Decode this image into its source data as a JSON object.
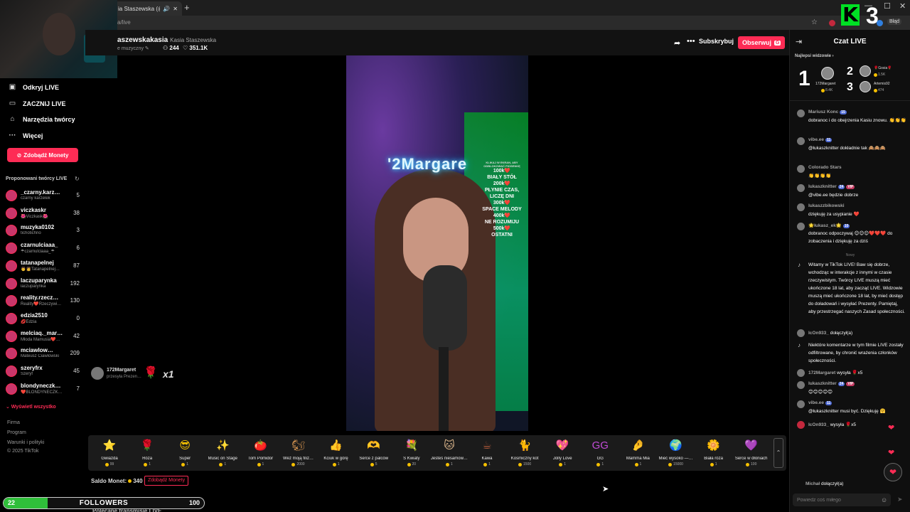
{
  "browser": {
    "tab_title": "ia Staszewska (@stasz…",
    "url": "a/live",
    "error_button": "Błąd",
    "win_controls": [
      "—",
      "☐",
      "✕"
    ]
  },
  "overlay": {
    "k_number": "3"
  },
  "sidebar": {
    "nav": [
      {
        "label": "Odkryj LIVE",
        "icon": "live-icon"
      },
      {
        "label": "ZACZNIJ LIVE",
        "icon": "camera-icon"
      },
      {
        "label": "Narzędzia twórcy",
        "icon": "home-icon"
      },
      {
        "label": "Więcej",
        "icon": "more-icon"
      }
    ],
    "coins_button": "Zdobądź Monety",
    "suggested_title": "Proponowani twórcy LIVE",
    "creators": [
      {
        "name": "_czarny.karz…",
        "sub": "czarny karzelek",
        "count": "5"
      },
      {
        "name": "viczkaskr",
        "sub": "🌺Viczkask🌺",
        "count": "38"
      },
      {
        "name": "muzyka0102",
        "sub": "tichotichno",
        "count": "3"
      },
      {
        "name": "czarnulciaaa_",
        "sub": "☂czarnulciaaa_☂",
        "count": "6"
      },
      {
        "name": "tatanapelnej",
        "sub": "👨👩Tatanapelnej…",
        "count": "87"
      },
      {
        "name": "laczuparynka",
        "sub": "laczuparynka",
        "count": "192"
      },
      {
        "name": "reality.rzecz…",
        "sub": "Reality❤️Rzeczywi…",
        "count": "130"
      },
      {
        "name": "edzia2510",
        "sub": "💋Edzia",
        "count": "0"
      },
      {
        "name": "melciaq._mar…",
        "sub": "Młoda Mamusia❤️…",
        "count": "42"
      },
      {
        "name": "mciawlow…",
        "sub": "Mateusz Ciawlowski",
        "count": "209"
      },
      {
        "name": "szeryfrx",
        "sub": "Szeryf",
        "count": "45"
      },
      {
        "name": "blondyneczk…",
        "sub": "❤️BLONDYNECZK…",
        "count": "7"
      }
    ],
    "show_all": "⌄ Wyświetl wszystko",
    "footer": [
      "Firma",
      "Program",
      "Warunki i polityki",
      "© 2025 TikTok"
    ]
  },
  "header": {
    "username": "aszewskakasia",
    "nickname": "Kasia Staszewska",
    "category": "e muzyczny",
    "viewers": "244",
    "likes": "351.1K",
    "subscribe": "Subskrybuj",
    "follow": "Obserwuj",
    "follow_key": "G"
  },
  "video": {
    "neon_text": "'2Margare",
    "goals_intro": "KLIKAJ W EKRAN, ABY ODBLOKOWAĆ PIOSENKĘ",
    "goals": [
      {
        "amount": "100k❤️",
        "song": "BIAŁY STÓŁ"
      },
      {
        "amount": "200k❤️",
        "song": "PŁYNIE CZAS, LICZĘ DNI"
      },
      {
        "amount": "300k❤️",
        "song": "SPACE MELODY"
      },
      {
        "amount": "400k❤️",
        "song": "NE ROZUMIJU"
      },
      {
        "amount": "500k❤️",
        "song": "OSTATNI"
      }
    ]
  },
  "gift_notification": {
    "user": "172Margaret",
    "sub": "przesyła Prezen…",
    "count": "x1"
  },
  "gifts": [
    {
      "name": "Gwiazda",
      "price": "99",
      "icon": "⭐",
      "color": "#f3d21a"
    },
    {
      "name": "Róża",
      "price": "1",
      "icon": "🌹",
      "color": "#e0263f"
    },
    {
      "name": "Super",
      "price": "1",
      "icon": "😎",
      "color": "#f6c000"
    },
    {
      "name": "Music on Stage",
      "price": "1",
      "icon": "✨",
      "color": "#8a6cff"
    },
    {
      "name": "Tom Pomidor",
      "price": "1",
      "icon": "🍅",
      "color": "#e8483b"
    },
    {
      "name": "Weź moją filiż…",
      "price": "2000",
      "icon": "🐿",
      "color": "#c68a4b"
    },
    {
      "name": "Kciuk w górę",
      "price": "1",
      "icon": "👍",
      "color": "#f6a41a"
    },
    {
      "name": "Serce z palców",
      "price": "5",
      "icon": "🫶",
      "color": "#f4a08c"
    },
    {
      "name": "S Kwiaty",
      "price": "20",
      "icon": "💐",
      "color": "#e46fb0"
    },
    {
      "name": "Jesteś niesamow…",
      "price": "1",
      "icon": "🐱",
      "color": "#d9b48a"
    },
    {
      "name": "Kawa",
      "price": "1",
      "icon": "☕",
      "color": "#b05a3a"
    },
    {
      "name": "Kosmiczny kot",
      "price": "1500",
      "icon": "🐈",
      "color": "#4b6de0"
    },
    {
      "name": "Jolly Love",
      "price": "1",
      "icon": "💖",
      "color": "#f08aa6"
    },
    {
      "name": "GG",
      "price": "1",
      "icon": "GG",
      "color": "#c04bd6"
    },
    {
      "name": "Mamma Mia",
      "price": "1",
      "icon": "🤌",
      "color": "#f4a08c"
    },
    {
      "name": "Mieć wysoko —…",
      "price": "15000",
      "icon": "🌍",
      "color": "#7aa0d6"
    },
    {
      "name": "Biała róża",
      "price": "1",
      "icon": "🌼",
      "color": "#f0f0d0"
    },
    {
      "name": "Serce w dłoniach",
      "price": "100",
      "icon": "💜",
      "color": "#b05ad6"
    }
  ],
  "balance": {
    "label": "Saldo Monet:",
    "amount": "340",
    "button": "Zdobądź Monety"
  },
  "followers_goal": {
    "current": "22",
    "label": "FOLLOWERS",
    "target": "100",
    "progress": 0.22
  },
  "recommended": "Polecane transmisje LIVE",
  "chat": {
    "title": "Czat LIVE",
    "top_title": "Najlepsi widzowie ›",
    "top": [
      {
        "rank": "1",
        "name": "172Margaret",
        "score": "8.4K"
      },
      {
        "rank": "2",
        "name": "🌹Gosia🌹",
        "score": "1.5K"
      },
      {
        "rank": "3",
        "name": "Artemis92",
        "score": "474"
      }
    ],
    "messages": [
      {
        "user": "Mariusz Konc",
        "badge": "15",
        "text": "dobranoc i do obejrzenia Kasiu znowu. 👏👏👏"
      },
      {
        "user": "vibe.ee",
        "badge": "11",
        "text": "@łukaszknitter dokładnie tak 🙈🙈🙈"
      },
      {
        "user": "Colorado Stars",
        "badge": "",
        "text": "👏👏👏👏"
      },
      {
        "user": "lukaszknitter",
        "badge": "24",
        "vip": "VIP",
        "text": "@vibe.ee będzie dobrze"
      },
      {
        "user": "lukaszzbikowski",
        "badge": "",
        "text": "dziękuję za usypianie ❤️"
      },
      {
        "user": "🌟łukasz_ek🌟",
        "badge": "10",
        "text": "dobranoc odpoczywaj 😊😊😊❤️❤️❤️ do zobaczenia i dziękuję za dziś"
      }
    ],
    "new_divider": "Nowy",
    "system_welcome": "Witamy w TikTok LIVE! Baw się dobrze, wchodząc w interakcje z innymi w czasie rzeczywistym. Twórcy LIVE muszą mieć ukończone 18 lat, aby zacząć LIVE. Widzowie muszą mieć ukończone 18 lat, by mieć dostęp do doładowań i wysyłać Prezenty. Pamiętaj, aby przestrzegać naszych Zasad społeczności.",
    "join1_user": "IcOn933_",
    "join1_text": "dołączył(a)",
    "system_filter": "Niektóre komentarze w tym filmie LIVE zostały odfiltrowane, by chronić wrażenia członków społeczności.",
    "gift1_user": "172Margaret",
    "gift1_text": "wysyła 🌹x5",
    "msg_late": [
      {
        "user": "lukaszknitter",
        "badge": "24",
        "vip": "VIP",
        "text": "😊😊😊😊😊"
      },
      {
        "user": "vibe.ee",
        "badge": "11",
        "text": "@łukaszknitter musi być. Dziękuję 🤗"
      }
    ],
    "gift2_user": "IcOn933_",
    "gift2_text": "wysyła 🌹x5",
    "join2_user": "Michał",
    "join2_text": "dołączył(a)",
    "input_placeholder": "Powiedz coś miłego"
  }
}
